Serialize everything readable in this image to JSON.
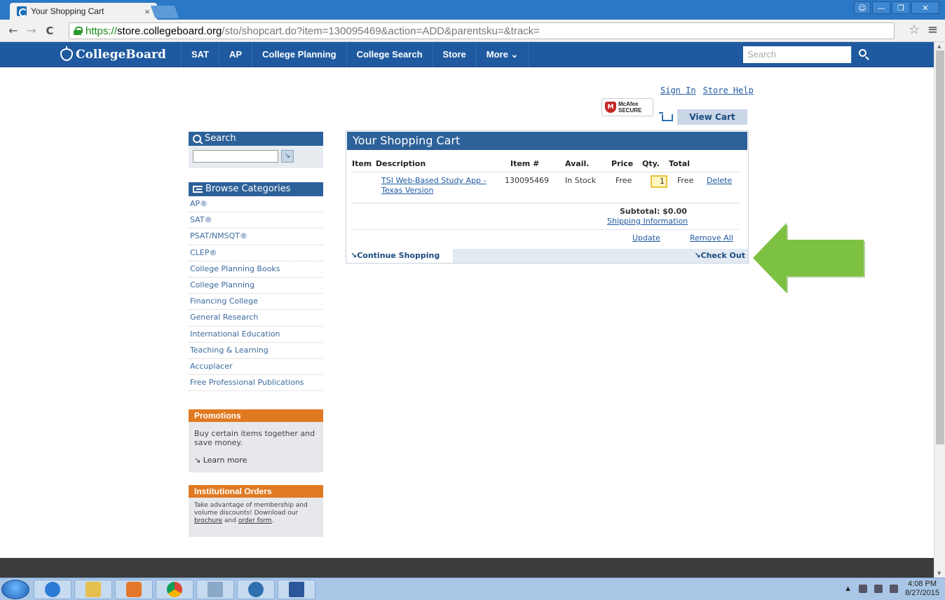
{
  "browser": {
    "tab_title": "Your Shopping Cart",
    "tab_close": "×",
    "url_https": "https://",
    "url_host": "store.collegeboard.org",
    "url_path": "/sto/shopcart.do?item=130095469&action=ADD&parentsku=&track=",
    "back": "←",
    "forward": "→",
    "reload": "C",
    "star": "☆",
    "menu": "≡"
  },
  "site_nav": {
    "logo": "CollegeBoard",
    "items": [
      "SAT",
      "AP",
      "College Planning",
      "College Search",
      "Store",
      "More ⌄"
    ],
    "search_placeholder": "Search"
  },
  "header": {
    "sign_in": "Sign In",
    "store_help": "Store Help",
    "mcafee_line1": "McAfee",
    "mcafee_line2": "SECURE",
    "view_cart": "View Cart"
  },
  "sidebar": {
    "search_title": "Search",
    "browse_title": "Browse Categories",
    "categories": [
      "AP®",
      "SAT®",
      "PSAT/NMSQT®",
      "CLEP®",
      "College Planning Books",
      "College Planning",
      "Financing College",
      "General Research",
      "International Education",
      "Teaching & Learning",
      "Accuplacer",
      "Free Professional Publications"
    ],
    "promotions": {
      "title": "Promotions",
      "body": "Buy certain items together and save money.",
      "link": "↘ Learn more"
    },
    "institutional": {
      "title": "Institutional Orders",
      "body": "Take advantage of membership and volume discounts! Download our",
      "brochure": "brochure",
      "and": "and",
      "order_form": "order form",
      "period": "."
    }
  },
  "cart": {
    "title": "Your Shopping Cart",
    "columns": {
      "item": "Item",
      "description": "Description",
      "item_no": "Item #",
      "avail": "Avail.",
      "price": "Price",
      "qty": "Qty.",
      "total": "Total"
    },
    "line": {
      "description_1": "TSI Web-Based Study App -",
      "description_2": "Texas Version",
      "item_no": "130095469",
      "avail": "In Stock",
      "price": "Free",
      "qty": "1",
      "total": "Free",
      "delete": "Delete"
    },
    "subtotal": "Subtotal: $0.00",
    "shipping_info": "Shipping Information",
    "update": "Update",
    "remove_all": "Remove All",
    "continue_shopping": "↘Continue Shopping",
    "check_out": "↘Check Out"
  },
  "taskbar": {
    "time": "4:08 PM",
    "date": "8/27/2015"
  },
  "colors": {
    "nav_blue": "#1f5aa0",
    "panel_blue": "#2d6199",
    "promo_orange": "#e07a22",
    "arrow_green": "#7cc142"
  }
}
